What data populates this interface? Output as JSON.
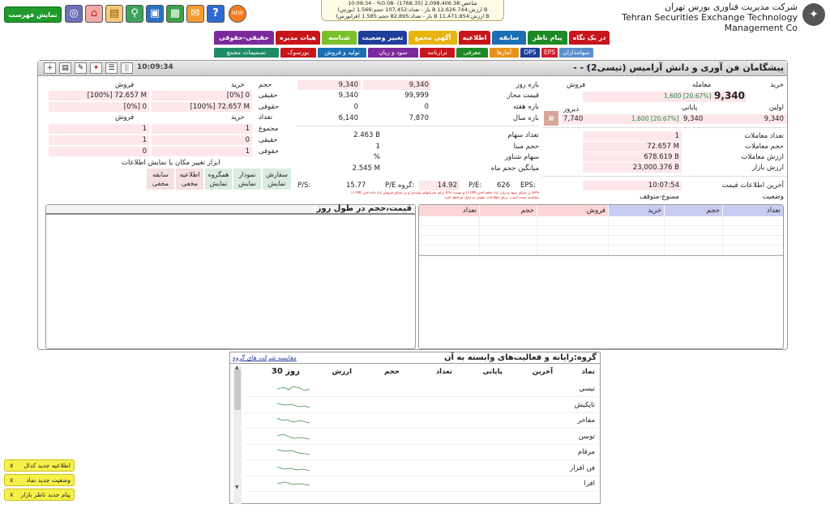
{
  "top": {
    "show_list": "نمایش فهرست",
    "new_badge": "NEW",
    "ticker_lines": [
      "10:09:34 - %0.08- (1768.35) شاخص:2,098,406.38",
      "(بورس) باز - تعداد:107,452 حجم:1.566 B ارزش:12,626.744 B",
      "(فرابورس) باز - تعداد:82,895 حجم:1.585 B ارزش:11,471.854 B"
    ],
    "company_fa": "شرکت مدیریت فناوری بورس تهران",
    "company_en": "Tehran Securities Exchange Technology Management Co"
  },
  "tabs_row1": [
    {
      "label": "در یک نگاه",
      "color": "#c8151b"
    },
    {
      "label": "پیام ناظر",
      "color": "#1d8a26"
    },
    {
      "label": "سابقه",
      "color": "#1a6fb5"
    },
    {
      "label": "اطلاعیه",
      "color": "#c8151b"
    },
    {
      "label": "آگهی مجمع",
      "color": "#e8b40f"
    },
    {
      "label": "تغییر وضعیت",
      "color": "#1f3e9b"
    },
    {
      "label": "شناسه",
      "color": "#7bbf2a"
    },
    {
      "label": "هیات مدیره",
      "color": "#c8151b"
    },
    {
      "label": "حقیقی-حقوقی",
      "color": "#7b2a9c"
    }
  ],
  "tabs_row2": [
    {
      "label": "سهامداران",
      "color": "#5a8fcf"
    },
    {
      "label": "EPS",
      "color": "#d11f2f"
    },
    {
      "label": "DPS",
      "color": "#1f3e9b"
    },
    {
      "label": "آمارها",
      "color": "#e5921b"
    },
    {
      "label": "معرفی",
      "color": "#1d8a26"
    },
    {
      "label": "ترازنامه",
      "color": "#c8151b"
    },
    {
      "label": "سود و زیان",
      "color": "#7b2a9c"
    },
    {
      "label": "تولید و فروش",
      "color": "#1a6fb5"
    },
    {
      "label": "بورسوک",
      "color": "#c8151b"
    },
    {
      "label": "تصمیمات مجمع",
      "color": "#1f8a66"
    }
  ],
  "panel": {
    "time": "10:09:34",
    "title": "پیشگامان فن آوری و دانش آرامیس (تیسی2) - -"
  },
  "left": {
    "h_sell": "فروش",
    "h_buy": "خرید",
    "h_vol": "حجم",
    "r1": {
      "label": "حقیقی",
      "buy": "[0%] 0",
      "sell": "[100%] 72.657 M"
    },
    "r2": {
      "label": "حقوقی",
      "buy": "[100%] 72.657 M",
      "sell": "[0%] 0"
    },
    "h_count": "تعداد",
    "c_total": "مجموع",
    "c_real": "حقیقی",
    "c_legal": "حقوقی",
    "counts": [
      {
        "buy": "1",
        "sell": "1"
      },
      {
        "buy": "0",
        "sell": "1"
      },
      {
        "buy": "1",
        "sell": "0"
      }
    ],
    "tools_title": "ابزار تغییر مکان یا نمایش اطلاعات",
    "tools": [
      {
        "line1": "سفارش",
        "line2": "نمایش"
      },
      {
        "line1": "نمودار",
        "line2": "نمایش"
      },
      {
        "line1": "همگروه",
        "line2": "نمایش"
      },
      {
        "line1": "اطلاعیه",
        "line2": "مخفی"
      },
      {
        "line1": "سابقه",
        "line2": "مخفی"
      }
    ]
  },
  "mid": {
    "rows": [
      {
        "label": "بازه روز",
        "a": "9,340",
        "b": "9,340"
      },
      {
        "label": "قیمت مجاز",
        "a": "99,999",
        "b": "9,340"
      },
      {
        "label": "بازه هفته",
        "a": "0",
        "b": "0"
      },
      {
        "label": "بازه سال",
        "a": "7,870",
        "b": "6,140"
      }
    ],
    "info": [
      {
        "label": "تعداد سهام",
        "value": "2.463 B"
      },
      {
        "label": "حجم مبنا",
        "value": "1"
      },
      {
        "label": "سهام شناور",
        "value": "%"
      },
      {
        "label": "میانگین حجم ماه",
        "value": "2.545 M"
      }
    ],
    "eps_label": "EPS:",
    "eps": "626",
    "pe_label": "P/E:",
    "pe": "14.92",
    "gpe_label": "P/E گروه:",
    "gpe": "15.77",
    "ps_label": "P/S:",
    "ps": "",
    "note1": "EPS بر مبنای سود و زیان 12 ماهه اخیر (TTM) و نسبت P/S برای شرکتهای تولیدی و بر مبنای فروش 12 ماه اخیر (TTM)",
    "note2": "محاسبه شده است. برای اطلاعات بیشتر به لینک مراجعه کنید."
  },
  "right": {
    "h_buy": "خرید",
    "h_trade": "معامله",
    "h_sell": "فروش",
    "last": "9,340",
    "last_pct": "1,600 [20.67%]",
    "h_first": "اولین",
    "h_close": "پایانی",
    "h_prev": "دیروز",
    "first": "9,340",
    "close": "9,340",
    "close_pct": "1,600 [20.67%]",
    "prev": "7,740",
    "stats": [
      {
        "label": "تعداد معاملات",
        "value": "1"
      },
      {
        "label": "حجم معاملات",
        "value": "72.657 M"
      },
      {
        "label": "ارزش معاملات",
        "value": "678.619 B"
      },
      {
        "label": "ارزش بازار",
        "value": "23,000.376 B"
      }
    ],
    "last_info_label": "آخرین اطلاعات قیمت",
    "last_info": "10:07:54",
    "state_label": "وضعیت",
    "state": "ممنوع-متوقف"
  },
  "chart_box": {
    "title": "قیمت،حجم در طول روز"
  },
  "order_grid": {
    "headers": [
      "تعداد",
      "حجم",
      "خرید",
      "فروش",
      "حجم",
      "تعداد"
    ]
  },
  "peer": {
    "title": "گروه:رایانه و فعالیت‌های وابسته به آن",
    "compare": "مقایسه شرکت های گروه",
    "headers": [
      "نماد",
      "آخرین",
      "پایانی",
      "تعداد",
      "حجم",
      "ارزش",
      "30 روز"
    ],
    "rows": [
      "تیسي",
      "تاپکیش",
      "مفاخر",
      "توسن",
      "مرقام",
      "فن افزار",
      "افرا"
    ]
  },
  "toasts": [
    "اطلاعیه جدید کدال",
    "وضعیت جدید نماد",
    "پیام جدید ناظر بازار"
  ]
}
